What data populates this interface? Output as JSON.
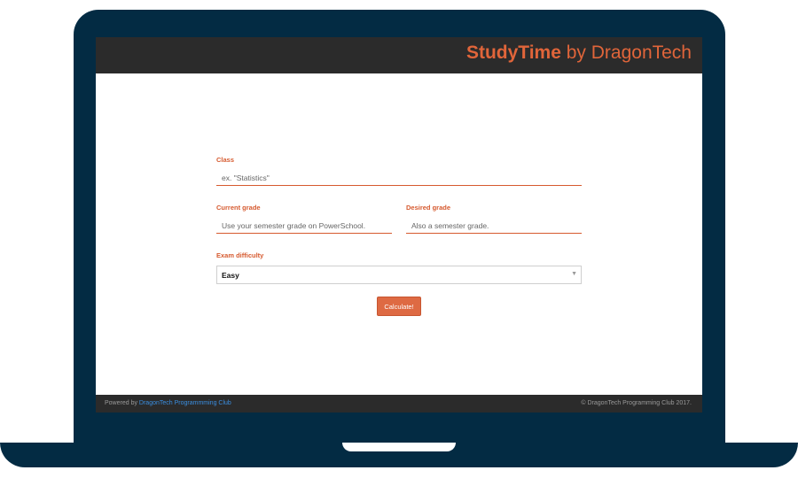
{
  "header": {
    "brand_strong": "StudyTime",
    "brand_rest": " by DragonTech"
  },
  "form": {
    "class": {
      "label": "Class",
      "placeholder": "ex. \"Statistics\""
    },
    "current_grade": {
      "label": "Current grade",
      "placeholder": "Use your semester grade on PowerSchool."
    },
    "desired_grade": {
      "label": "Desired grade",
      "placeholder": "Also a semester grade."
    },
    "exam_difficulty": {
      "label": "Exam difficulty",
      "selected": "Easy"
    },
    "submit_label": "Calculate!"
  },
  "footer": {
    "powered_prefix": "Powered by ",
    "powered_link": "DragonTech Programmming Club",
    "copyright": "© DragonTech Programming Club 2017."
  },
  "colors": {
    "accent": "#e0653a",
    "frame": "#032b43",
    "bar": "#2b2b2b",
    "link": "#3a8ee0"
  }
}
